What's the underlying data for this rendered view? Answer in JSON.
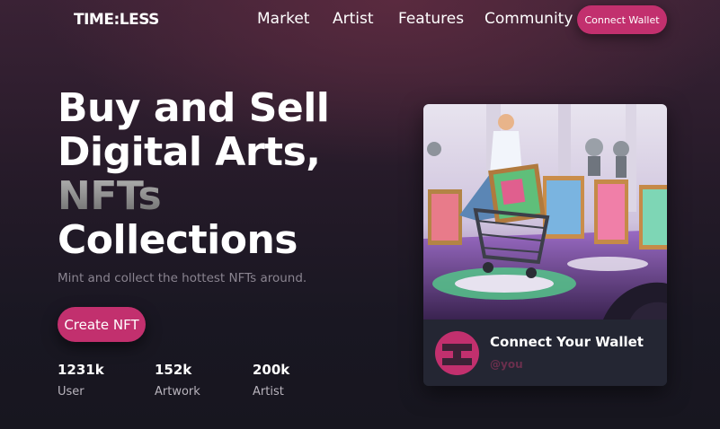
{
  "brand": {
    "logo_text": "TIME:LESS"
  },
  "nav": {
    "items": [
      "Market",
      "Artist",
      "Features",
      "Community"
    ],
    "connect_label": "Connect Wallet"
  },
  "hero": {
    "title_lines": [
      "Buy and Sell",
      "Digital Arts,",
      "NFTs",
      "Collections"
    ],
    "subtitle": "Mint and collect the hottest NFTs around.",
    "cta_label": "Create NFT"
  },
  "stats": [
    {
      "value": "1231k",
      "label": "User"
    },
    {
      "value": "152k",
      "label": "Artwork"
    },
    {
      "value": "200k",
      "label": "Artist"
    }
  ],
  "card": {
    "title": "Connect Your Wallet",
    "handle": "@you",
    "image_icon": "nft-shopping-illustration"
  },
  "colors": {
    "accent": "#c2306e",
    "background_top": "#3a2235",
    "background_bottom": "#17161f",
    "card_bg": "#242633",
    "handle": "#6b2f4d"
  }
}
